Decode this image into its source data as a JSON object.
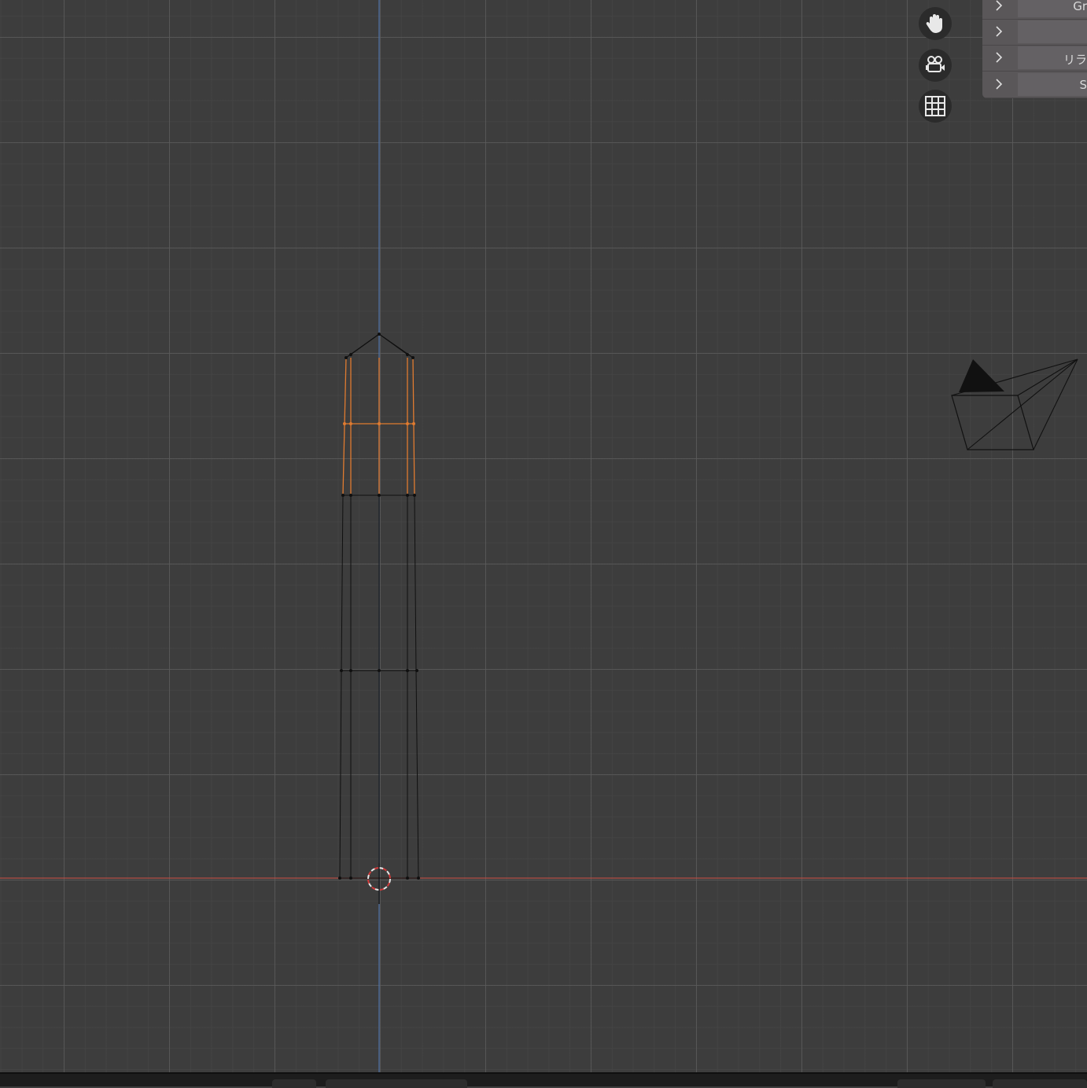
{
  "viewport": {
    "colors": {
      "background": "#3d3d3d",
      "x_axis": "#b34e44",
      "z_axis": "#4f73a8",
      "selected_edge": "#e07b30",
      "wire": "#101010"
    }
  },
  "navigation": [
    {
      "icon": "hand-pan-icon"
    },
    {
      "icon": "camera-view-icon"
    },
    {
      "icon": "grid-ortho-icon"
    }
  ],
  "side_panel": {
    "rows": [
      {
        "label": "Gr"
      },
      {
        "label": ""
      },
      {
        "label": "リラ"
      },
      {
        "label": "S"
      }
    ]
  },
  "statusbar": {
    "icons": [
      "mouse-icon",
      "key-icon",
      "tool-icons"
    ]
  }
}
